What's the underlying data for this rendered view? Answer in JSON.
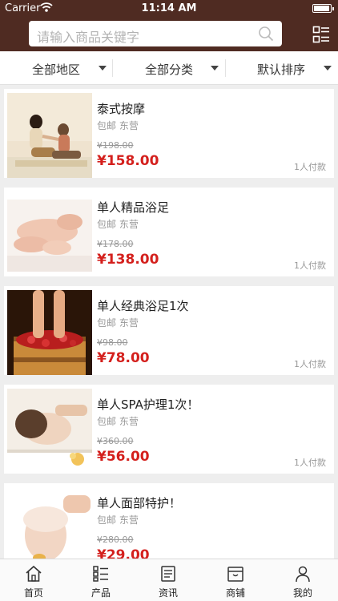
{
  "status_bar": {
    "carrier": "Carrier",
    "time": "11:14 AM"
  },
  "search": {
    "placeholder": "请输入商品关键字"
  },
  "filters": [
    {
      "label": "全部地区"
    },
    {
      "label": "全部分类"
    },
    {
      "label": "默认排序"
    }
  ],
  "products": [
    {
      "name": "泰式按摩",
      "tags": "包邮 东营",
      "old_price": "¥198.00",
      "price": "¥158.00",
      "sold": "1人付款"
    },
    {
      "name": "单人精品浴足",
      "tags": "包邮 东营",
      "old_price": "¥178.00",
      "price": "¥138.00",
      "sold": "1人付款"
    },
    {
      "name": "单人经典浴足1次",
      "tags": "包邮 东营",
      "old_price": "¥98.00",
      "price": "¥78.00",
      "sold": "1人付款"
    },
    {
      "name": "单人SPA护理1次！",
      "tags": "包邮 东营",
      "old_price": "¥360.00",
      "price": "¥56.00",
      "sold": "1人付款"
    },
    {
      "name": "单人面部特护！",
      "tags": "包邮 东营",
      "old_price": "¥280.00",
      "price": "¥29.00",
      "sold": ""
    }
  ],
  "tabs": [
    {
      "label": "首页",
      "icon": "home-icon"
    },
    {
      "label": "产品",
      "icon": "product-list-icon"
    },
    {
      "label": "资讯",
      "icon": "news-icon"
    },
    {
      "label": "商铺",
      "icon": "shop-icon"
    },
    {
      "label": "我的",
      "icon": "user-icon"
    }
  ],
  "colors": {
    "brand": "#4f2b22",
    "price": "#d4201d"
  }
}
